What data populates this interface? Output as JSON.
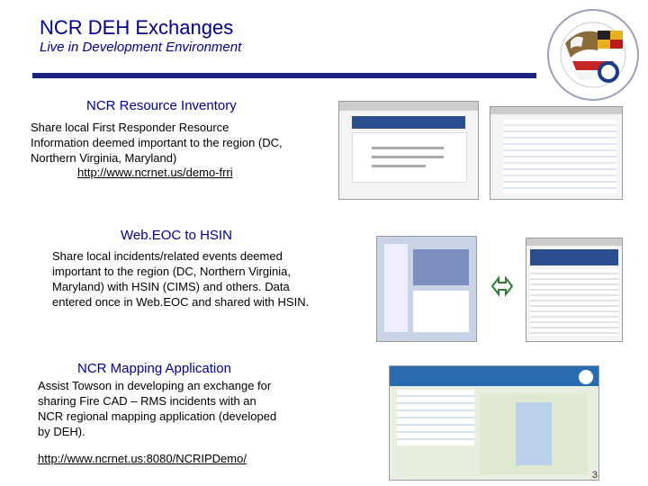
{
  "header": {
    "title": "NCR DEH Exchanges",
    "subtitle": "Live in Development Environment"
  },
  "sections": [
    {
      "title": "NCR Resource Inventory",
      "body": "Share local First Responder Resource Information deemed important to the region (DC, Northern Virginia, Maryland)",
      "link": "http://www.ncrnet.us/demo-frri"
    },
    {
      "title": "Web.EOC to HSIN",
      "body": "Share local incidents/related events deemed important to the region (DC, Northern Virginia, Maryland) with HSIN (CIMS) and others. Data entered once in Web.EOC and shared with HSIN."
    },
    {
      "title": "NCR Mapping Application",
      "body": "Assist Towson in developing an exchange for sharing Fire CAD – RMS incidents with an NCR regional mapping application (developed by DEH).",
      "link": "http://www.ncrnet.us:8080/NCRIPDemo/"
    }
  ],
  "page_number": "3",
  "colors": {
    "title": "#00008B",
    "rule": "#1a237e",
    "arrow": "#2e7d32"
  },
  "icons": [
    "ncr-seal-icon",
    "double-arrow-icon"
  ]
}
